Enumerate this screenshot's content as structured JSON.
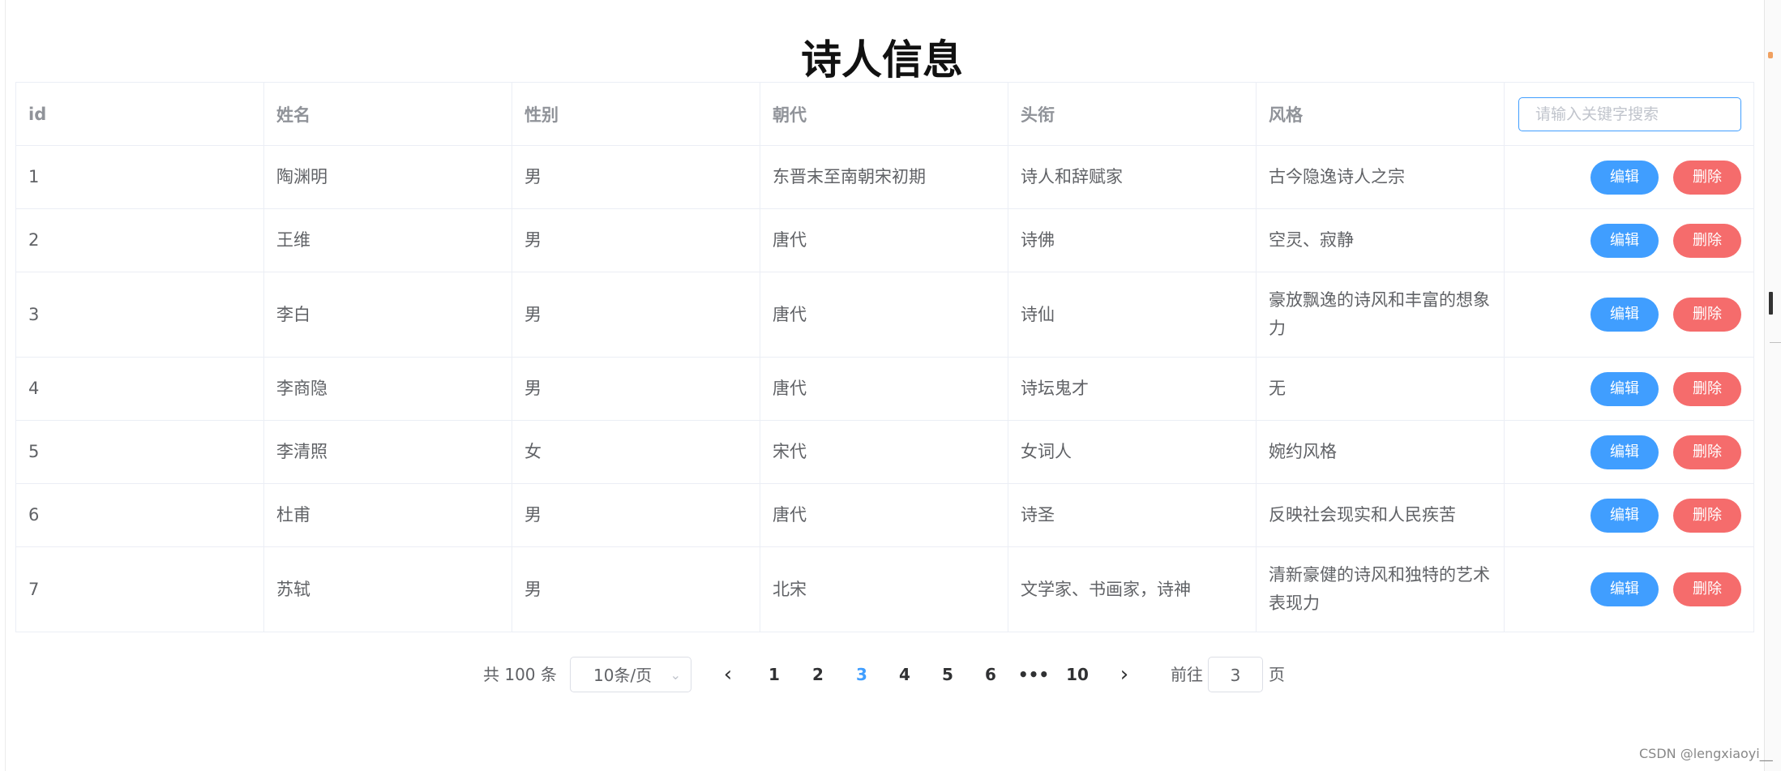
{
  "page": {
    "title": "诗人信息"
  },
  "table": {
    "columns": [
      "id",
      "姓名",
      "性别",
      "朝代",
      "头衔",
      "风格"
    ],
    "search_placeholder": "请输入关键字搜索",
    "edit_label": "编辑",
    "delete_label": "删除",
    "rows": [
      {
        "id": "1",
        "name": "陶渊明",
        "gender": "男",
        "dynasty": "东晋末至南朝宋初期",
        "title": "诗人和辞赋家",
        "style": "古今隐逸诗人之宗"
      },
      {
        "id": "2",
        "name": "王维",
        "gender": "男",
        "dynasty": "唐代",
        "title": "诗佛",
        "style": "空灵、寂静"
      },
      {
        "id": "3",
        "name": "李白",
        "gender": "男",
        "dynasty": "唐代",
        "title": "诗仙",
        "style": "豪放飘逸的诗风和丰富的想象力"
      },
      {
        "id": "4",
        "name": "李商隐",
        "gender": "男",
        "dynasty": "唐代",
        "title": "诗坛鬼才",
        "style": "无"
      },
      {
        "id": "5",
        "name": "李清照",
        "gender": "女",
        "dynasty": "宋代",
        "title": "女词人",
        "style": "婉约风格"
      },
      {
        "id": "6",
        "name": "杜甫",
        "gender": "男",
        "dynasty": "唐代",
        "title": "诗圣",
        "style": "反映社会现实和人民疾苦"
      },
      {
        "id": "7",
        "name": "苏轼",
        "gender": "男",
        "dynasty": "北宋",
        "title": "文学家、书画家，诗神",
        "style": "清新豪健的诗风和独特的艺术表现力"
      }
    ]
  },
  "pagination": {
    "total_text": "共 100 条",
    "page_size": "10条/页",
    "pages": [
      "1",
      "2",
      "3",
      "4",
      "5",
      "6",
      "•••",
      "10"
    ],
    "current_page": "3",
    "prev_icon": "chevron-left-icon",
    "next_icon": "chevron-right-icon",
    "goto_label": "前往",
    "goto_value": "3",
    "goto_unit": "页"
  },
  "watermark": "CSDN @lengxiaoyi__",
  "colors": {
    "primary": "#409eff",
    "danger": "#f56c6c",
    "border": "#ebeef5",
    "header_text": "#909399"
  }
}
